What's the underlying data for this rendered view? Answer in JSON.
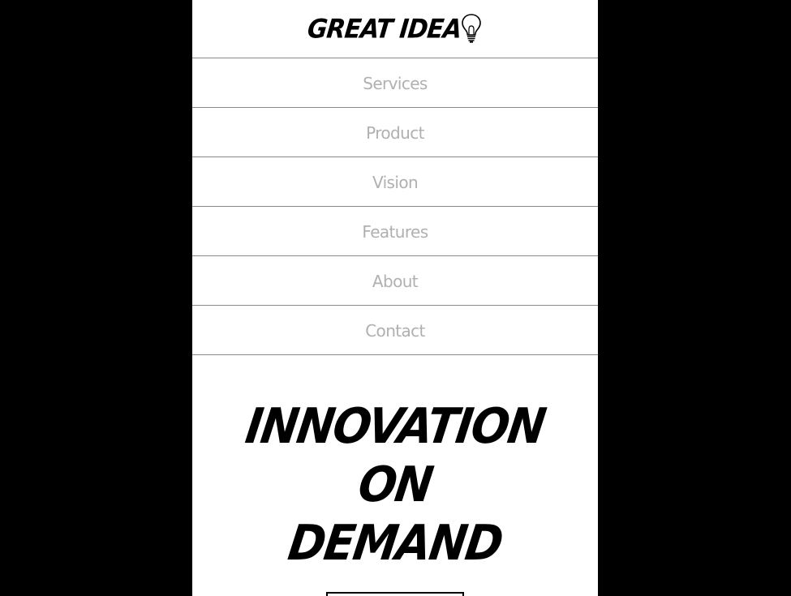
{
  "header": {
    "logo_text": "GREAT IDEA",
    "logo_icon": "lightbulb-icon"
  },
  "nav": {
    "items": [
      {
        "label": "Services"
      },
      {
        "label": "Product"
      },
      {
        "label": "Vision"
      },
      {
        "label": "Features"
      },
      {
        "label": "About"
      },
      {
        "label": "Contact"
      }
    ]
  },
  "hero": {
    "lines": [
      "INNOVATION",
      "ON",
      "DEMAND"
    ]
  },
  "colors": {
    "backdrop": "#000000",
    "page": "#ffffff",
    "nav_text": "#b0b0b0",
    "divider": "#8a8a8a",
    "hero_text": "#000000"
  }
}
